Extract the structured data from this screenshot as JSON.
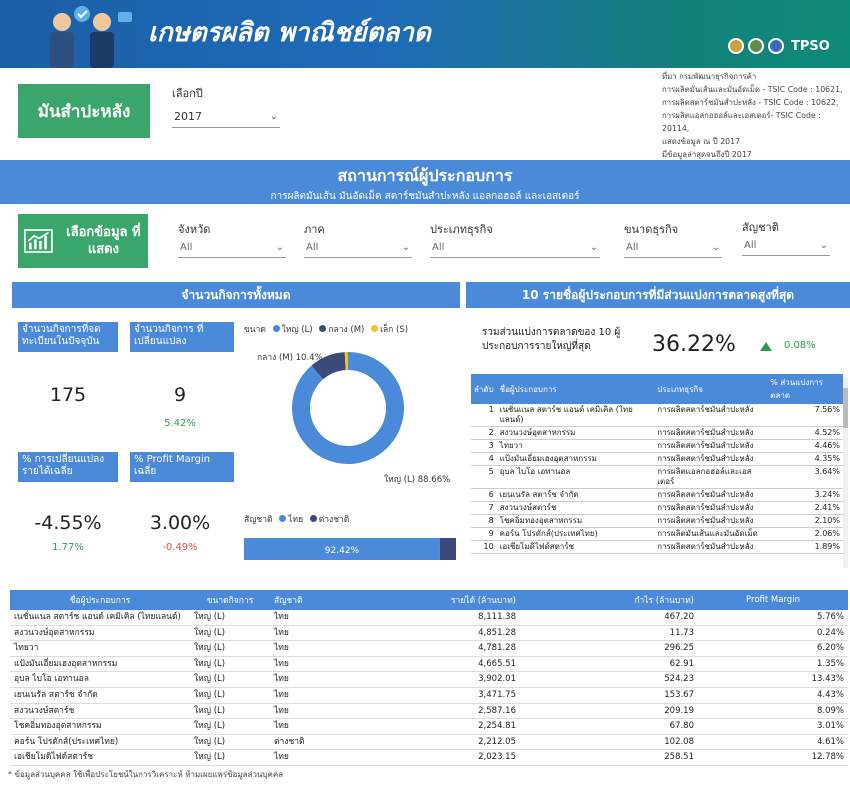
{
  "header": {
    "title": "เกษตรผลิต พาณิชย์ตลาด",
    "logo_text": "TPSO"
  },
  "product": "มันสำปะหลัง",
  "year_filter": {
    "label": "เลือกปี",
    "value": "2017"
  },
  "source": {
    "lines": [
      "ที่มา กรมพัฒนาธุรกิจการค้า",
      "การผลิตมันเส้นและมันอัดเม็ด - TSIC Code : 10621,",
      "การผลิตสตาร์ชมันสำปะหลัง - TSIC Code : 10622,",
      "การผลิตแอลกอฮอล์และเอสเตอร์- TSIC Code : 20114,",
      "แสดงข้อมูล ณ ปี  2017",
      "มีข้อมูลล่าสุดจนถึงปี   2017"
    ]
  },
  "banner": {
    "title": "สถานการณ์ผู้ประกอบการ",
    "subtitle": "การผลิตมันเส้น มันอัดเม็ด สตาร์ชมันสำปะหลัง แอลกอฮอล์ และเอสเตอร์"
  },
  "selector": {
    "label": "เลือกข้อมูล ที่แสดง",
    "filters": [
      {
        "label": "จังหวัด",
        "value": "All"
      },
      {
        "label": "ภาค",
        "value": "All"
      },
      {
        "label": "ประเภทธุรกิจ",
        "value": "All"
      },
      {
        "label": "ขนาดธุรกิจ",
        "value": "All"
      },
      {
        "label": "สัญชาติ",
        "value": "All"
      }
    ]
  },
  "left": {
    "header": "จำนวนกิจการทั้งหมด",
    "kpi1_label": "จำนวนกิจการที่จด ทะเบียนในปัจจุบัน",
    "kpi1_value": "175",
    "kpi2_label": "จำนวนกิจการ ที่เปลี่ยนแปลง",
    "kpi2_value": "9",
    "kpi2_sub": "5.42%",
    "kpi3_label": "% การเปลี่ยนแปลง รายได้เฉลี่ย",
    "kpi3_value": "-4.55%",
    "kpi3_sub": "1.77%",
    "kpi4_label": "% Profit Margin เฉลี่ย",
    "kpi4_value": "3.00%",
    "kpi4_sub": "-0.49%",
    "size_legend": {
      "title": "ขนาด",
      "items": [
        "ใหญ่ (L)",
        "กลาง (M)",
        "เล็ก (S)"
      ]
    },
    "nat_legend": {
      "title": "สัญชาติ",
      "items": [
        "ไทย",
        "ต่างชาติ"
      ]
    },
    "donut_label_m": "กลาง (M) 10.4%",
    "donut_label_l": "ใหญ่ (L) 88.66%",
    "nat_bar_label": "92.42%"
  },
  "chart_data": [
    {
      "type": "pie",
      "title": "",
      "labels": [
        "ใหญ่ (L)",
        "กลาง (M)",
        "เล็ก (S)"
      ],
      "values": [
        88.66,
        10.4,
        0.94
      ],
      "colors": [
        "#4a8ad9",
        "#3b4a7a",
        "#f2c12e"
      ]
    },
    {
      "type": "bar",
      "title": "",
      "categories": [
        "สัญชาติ"
      ],
      "series": [
        {
          "name": "ไทย",
          "values": [
            92.42
          ]
        },
        {
          "name": "ต่างชาติ",
          "values": [
            7.58
          ]
        }
      ],
      "colors": [
        "#4a8ad9",
        "#3b4a7a"
      ]
    }
  ],
  "right": {
    "header": "10 รายชื่อผู้ประกอบการที่มีส่วนแบ่งการตลาดสูงที่สุด",
    "share_label": "รวมส่วนแบ่งการตลาดของ 10 ผู้ประกอบการรายใหญ่ที่สุด",
    "share_value": "36.22%",
    "share_change": "0.08%",
    "table_headers": [
      "ลำดับ",
      "ชื่อผู้ประกอบการ",
      "ประเภทธุรกิจ",
      "% ส่วนแบ่งการตลาด"
    ],
    "rows": [
      [
        "1",
        "เนชั่นแนล สตาร์ช แอนด์ เคมิเคิล (ไทยแลนด์)",
        "การผลิตสตาร์ชมันสำปะหลัง",
        "7.56%"
      ],
      [
        "2",
        "สงวนวงษ์อุตสาหกรรม",
        "การผลิตสตาร์ชมันสำปะหลัง",
        "4.52%"
      ],
      [
        "3",
        "ไทยวา",
        "การผลิตสตาร์ชมันสำปะหลัง",
        "4.46%"
      ],
      [
        "4",
        "แป้งมันเอี่ยมเฮงอุตสาหกรรม",
        "การผลิตสตาร์ชมันสำปะหลัง",
        "4.35%"
      ],
      [
        "5",
        "อุบล ไบโอ เอทานอล",
        "การผลิตแอลกอฮอล์และเอสเตอร์",
        "3.64%"
      ],
      [
        "6",
        "เยนเนรัล สตาร์ช จำกัด",
        "การผลิตสตาร์ชมันสำปะหลัง",
        "3.24%"
      ],
      [
        "7",
        "สงวนวงษ์สตาร์ช",
        "การผลิตสตาร์ชมันสำปะหลัง",
        "2.41%"
      ],
      [
        "8",
        "โชคอิ่มทองอุตสาหกรรม",
        "การผลิตสตาร์ชมันสำปะหลัง",
        "2.10%"
      ],
      [
        "9",
        "คอร์น โปรดักส์(ประเทศไทย)",
        "การผลิตมันเส้นและมันอัดเม็ด",
        "2.06%"
      ],
      [
        "10",
        "เอเชียโมดิไฟด์สตาร์ช",
        "การผลิตสตาร์ชมันสำปะหลัง",
        "1.89%"
      ]
    ]
  },
  "bottom": {
    "headers": [
      "ชื่อผู้ประกอบการ",
      "ขนาดกิจการ",
      "สัญชาติ",
      "รายได้ (ล้านบาท)",
      "กำไร (ล้านบาท)",
      "Profit Margin"
    ],
    "rows": [
      [
        "เนชั่นแนล สตาร์ช แอนด์ เคมิเคิล (ไทยแลนด์)",
        "ใหญ่ (L)",
        "ไทย",
        "8,111.38",
        "467.20",
        "5.76%"
      ],
      [
        "สงวนวงษ์อุตสาหกรรม",
        "ใหญ่ (L)",
        "ไทย",
        "4,851.28",
        "11.73",
        "0.24%"
      ],
      [
        "ไทยวา",
        "ใหญ่ (L)",
        "ไทย",
        "4,781.28",
        "296.25",
        "6.20%"
      ],
      [
        "แป้งมันเอี่ยมเฮงอุตสาหกรรม",
        "ใหญ่ (L)",
        "ไทย",
        "4,665.51",
        "62.91",
        "1.35%"
      ],
      [
        "อุบล ไบโอ เอทานอล",
        "ใหญ่ (L)",
        "ไทย",
        "3,902.01",
        "524.23",
        "13.43%"
      ],
      [
        "เยนเนรัล สตาร์ช จำกัด",
        "ใหญ่ (L)",
        "ไทย",
        "3,471.75",
        "153.67",
        "4.43%"
      ],
      [
        "สงวนวงษ์สตาร์ช",
        "ใหญ่ (L)",
        "ไทย",
        "2,587.16",
        "209.19",
        "8.09%"
      ],
      [
        "โชคอิ่มทองอุตสาหกรรม",
        "ใหญ่ (L)",
        "ไทย",
        "2,254.81",
        "67.80",
        "3.01%"
      ],
      [
        "คอร์น โปรดักส์(ประเทศไทย)",
        "ใหญ่ (L)",
        "ต่างชาติ",
        "2,212.05",
        "102.08",
        "4.61%"
      ],
      [
        "เอเชียโมดิไฟด์สตาร์ช",
        "ใหญ่ (L)",
        "ไทย",
        "2,023.15",
        "258.51",
        "12.78%"
      ]
    ]
  },
  "footnote": "* ข้อมูลส่วนบุคคล ใช้เพื่อประโยชน์ในการวิเคราะห์ ห้ามเผยแพร่ข้อมูลส่วนบุคคล"
}
